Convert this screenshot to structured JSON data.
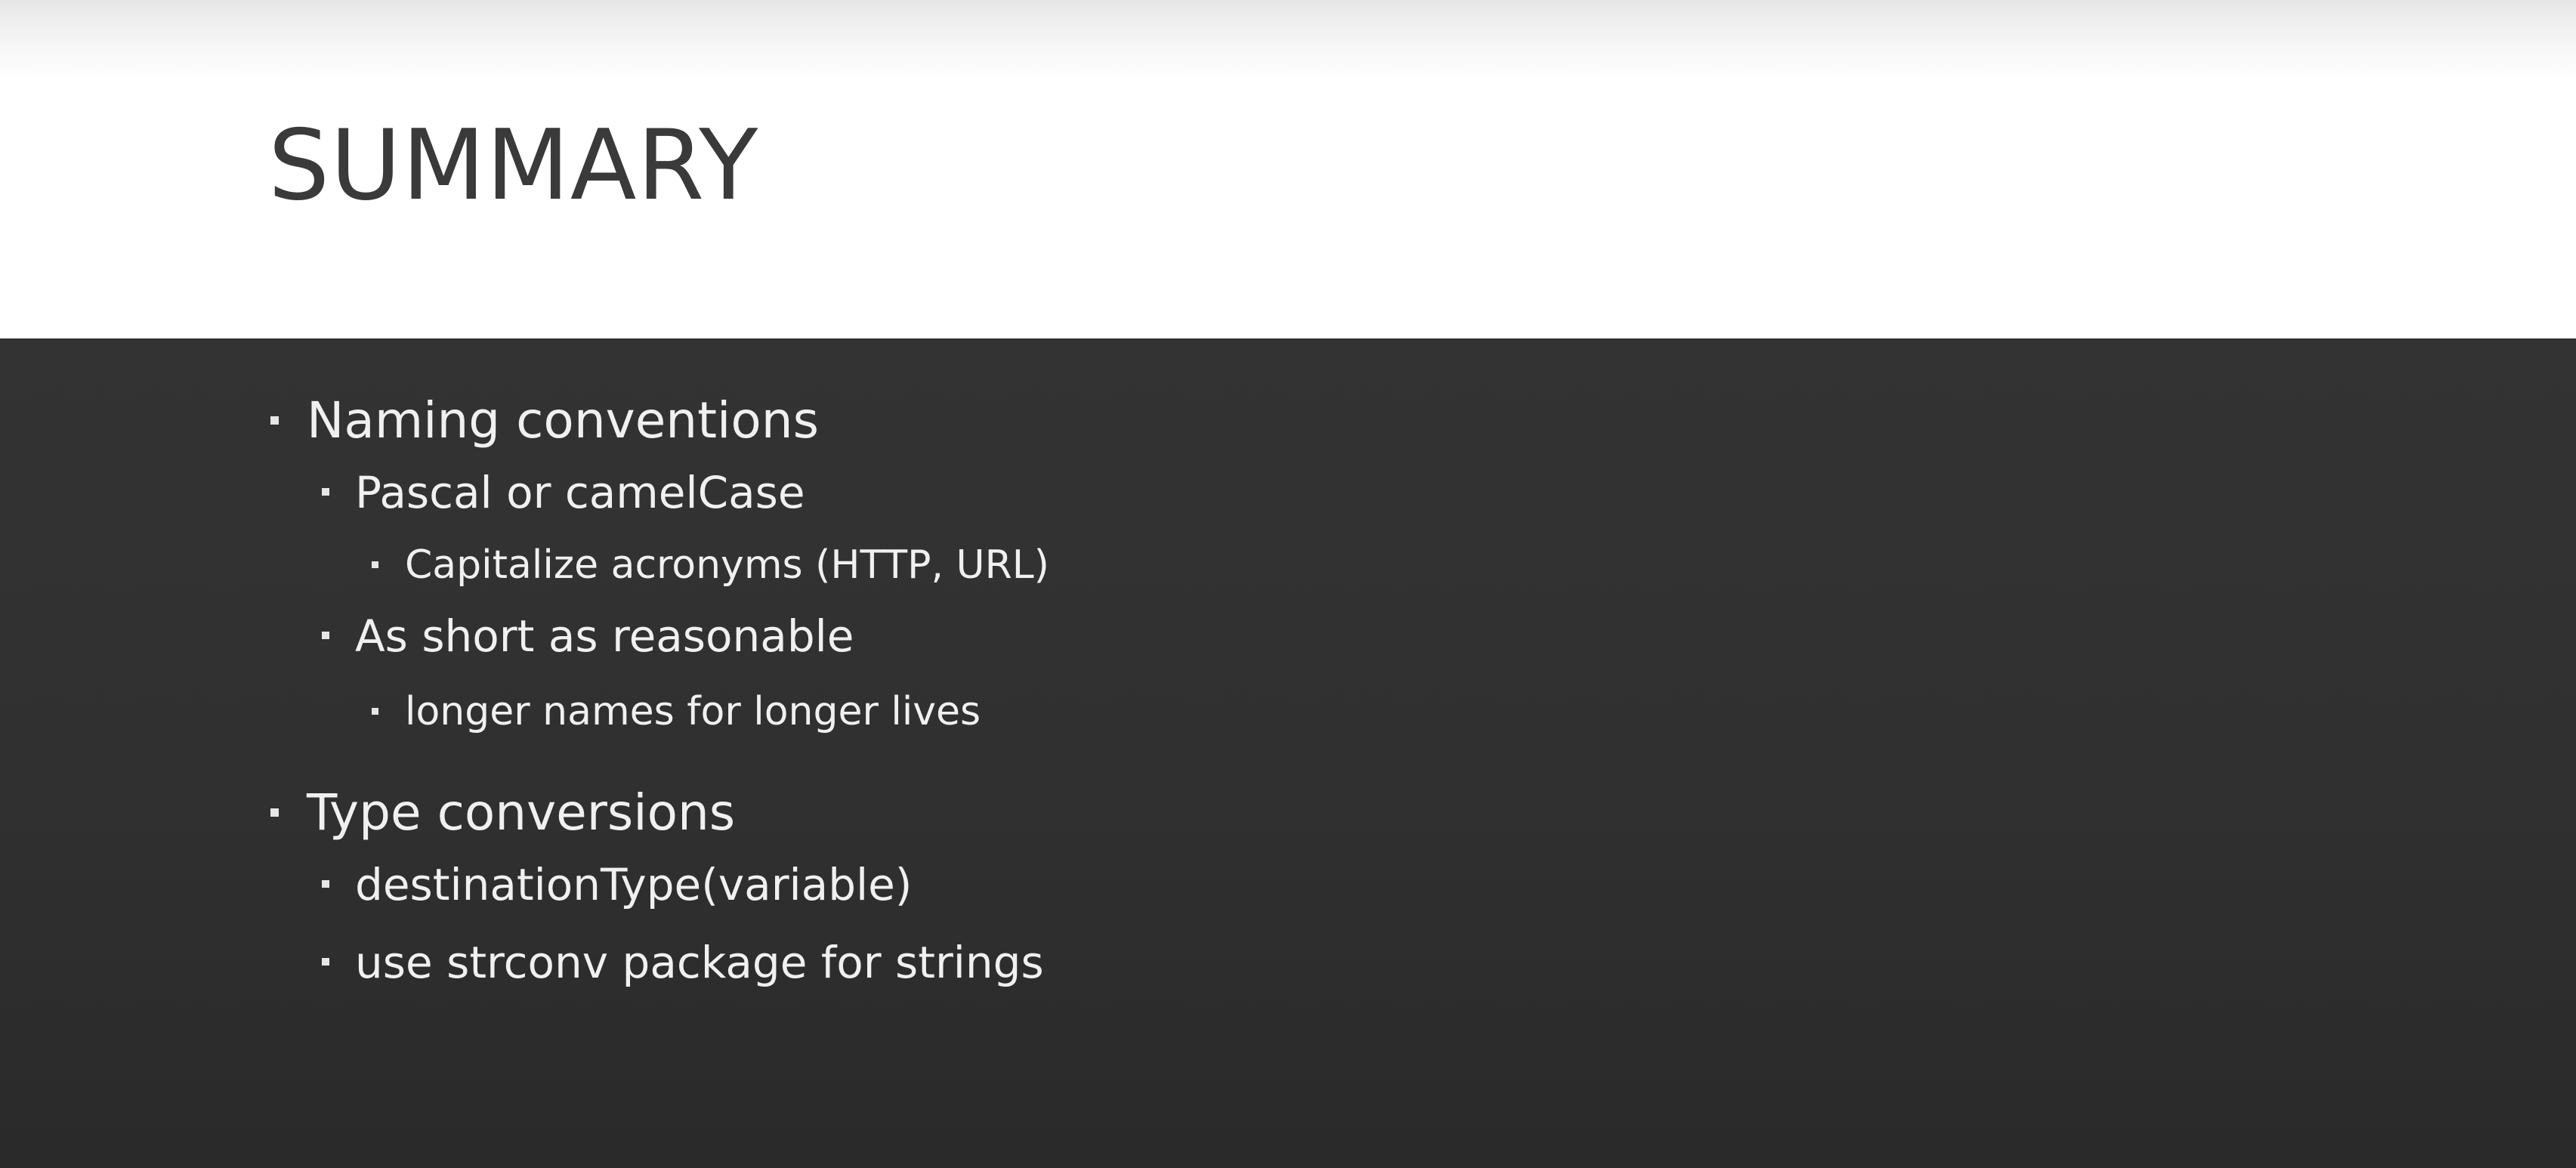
{
  "slide": {
    "title": "SUMMARY",
    "bullets": [
      {
        "text": "Naming conventions"
      },
      {
        "text": "Pascal or camelCase"
      },
      {
        "text": "Capitalize acronyms (HTTP, URL)"
      },
      {
        "text": "As short as reasonable"
      },
      {
        "text": "longer names for longer lives"
      },
      {
        "text": "Type conversions"
      },
      {
        "text": "destinationType(variable)"
      },
      {
        "text": "use strconv package for strings"
      }
    ]
  }
}
